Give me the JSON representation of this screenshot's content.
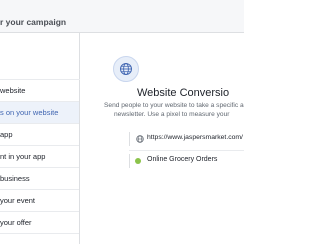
{
  "header": {
    "title": "r your campaign"
  },
  "sidebar": {
    "items": [
      {
        "label": "website",
        "active": false
      },
      {
        "label": "s on your website",
        "active": true
      },
      {
        "label": "app",
        "active": false
      },
      {
        "label": "nt in your app",
        "active": false
      },
      {
        "label": "business",
        "active": false
      },
      {
        "label": "your event",
        "active": false
      },
      {
        "label": "your offer",
        "active": false
      }
    ]
  },
  "main": {
    "icon": "globe-icon",
    "title": "Website Conversio",
    "description_line1": "Send people to your website to take a specific acti",
    "description_line2": "newsletter. Use a pixel to measure your",
    "url": {
      "icon": "globe-icon",
      "value": "https://www.jaspersmarket.com/"
    },
    "pixel": {
      "status_color": "#8bc34a",
      "label": "Online Grocery Orders"
    }
  },
  "colors": {
    "accent": "#4267b2",
    "active_bg": "#edf2fa",
    "status_green": "#8bc34a"
  }
}
